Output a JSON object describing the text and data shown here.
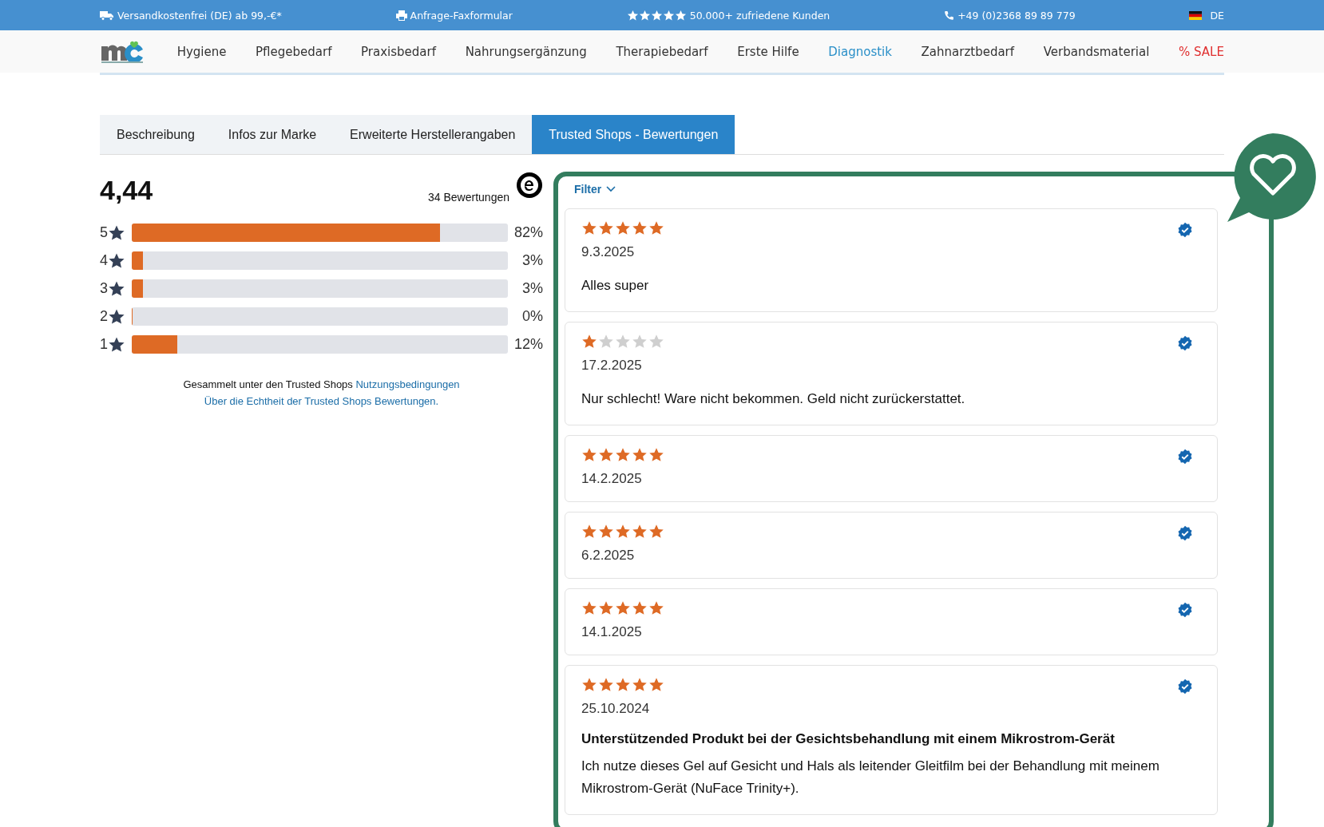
{
  "topbar": [
    {
      "kind": "truck",
      "text": "Versandkostenfrei (DE) ab 99,-€*"
    },
    {
      "kind": "printer",
      "text": "Anfrage-Faxformular"
    },
    {
      "kind": "stars",
      "text": "50.000+ zufriedene Kunden"
    },
    {
      "kind": "phone",
      "text": "+49 (0)2368 89 89 779"
    },
    {
      "kind": "flag",
      "text": "DE"
    }
  ],
  "nav": [
    {
      "label": "Hygiene",
      "selected": false,
      "kind": "normal"
    },
    {
      "label": "Pflegebedarf",
      "selected": false,
      "kind": "normal"
    },
    {
      "label": "Praxisbedarf",
      "selected": false,
      "kind": "normal"
    },
    {
      "label": "Nahrungsergänzung",
      "selected": false,
      "kind": "normal"
    },
    {
      "label": "Therapiebedarf",
      "selected": false,
      "kind": "normal"
    },
    {
      "label": "Erste Hilfe",
      "selected": false,
      "kind": "normal"
    },
    {
      "label": "Diagnostik",
      "selected": true,
      "kind": "normal"
    },
    {
      "label": "Zahnarztbedarf",
      "selected": false,
      "kind": "normal"
    },
    {
      "label": "Verbandsmaterial",
      "selected": false,
      "kind": "normal"
    },
    {
      "label": "% SALE",
      "selected": false,
      "kind": "sale"
    }
  ],
  "tabs": [
    {
      "label": "Beschreibung",
      "selected": false
    },
    {
      "label": "Infos zur Marke",
      "selected": false
    },
    {
      "label": "Erweiterte Herstellerangaben",
      "selected": false
    },
    {
      "label": "Trusted Shops - Bewertungen",
      "selected": true
    }
  ],
  "summary": {
    "score": "4,44",
    "count": "34 Bewertungen",
    "distribution": [
      {
        "label": "5",
        "level": 0.82,
        "percent": "82%"
      },
      {
        "label": "4",
        "level": 0.03,
        "percent": "3%"
      },
      {
        "label": "3",
        "level": 0.03,
        "percent": "3%"
      },
      {
        "label": "2",
        "level": 0,
        "percent": "0%"
      },
      {
        "label": "1",
        "level": 0.12,
        "percent": "12%"
      }
    ],
    "terms_text": "Gesammelt unter den Trusted Shops",
    "terms_link": "Nutzungsbedingungen",
    "authenticity_link": "Über die Echtheit der Trusted Shops Bewertungen."
  },
  "filter": {
    "label": "Filter",
    "expanded": false
  },
  "reviews": [
    {
      "stars": 5,
      "verified": true,
      "date": "9.3.2025",
      "text": "Alles super"
    },
    {
      "stars": 1,
      "verified": true,
      "date": "17.2.2025",
      "text": "Nur schlecht! Ware nicht bekommen. Geld nicht zurückerstattet."
    },
    {
      "stars": 5,
      "verified": true,
      "date": "14.2.2025"
    },
    {
      "stars": 5,
      "verified": true,
      "date": "6.2.2025"
    },
    {
      "stars": 5,
      "verified": true,
      "date": "14.1.2025"
    },
    {
      "stars": 5,
      "verified": true,
      "date": "25.10.2024",
      "title": "Unterstützended Produkt bei der Gesichtsbehandlung mit einem Mikrostrom-Gerät",
      "text": "Ich nutze dieses Gel auf Gesicht und Hals als leitender Gleitfilm bei der Behandlung mit meinem Mikrostrom-Gerät (NuFace Trinity+)."
    }
  ]
}
